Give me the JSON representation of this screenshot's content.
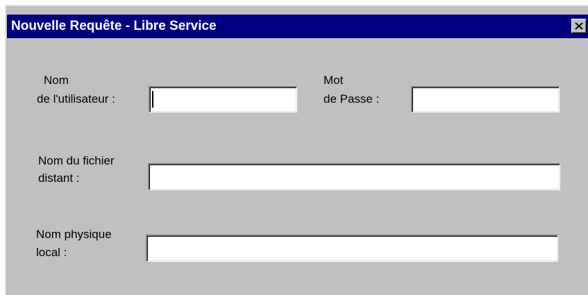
{
  "window": {
    "title": "Nouvelle Requête - Libre Service",
    "close_icon": "close-icon"
  },
  "form": {
    "username": {
      "label_line1": "Nom",
      "label_line2": "de l'utilisateur :",
      "value": ""
    },
    "password": {
      "label_line1": "Mot",
      "label_line2": "de Passe :",
      "value": ""
    },
    "remote_file": {
      "label_line1": "Nom du fichier",
      "label_line2": "distant :",
      "value": ""
    },
    "local_name": {
      "label_line1": "Nom physique",
      "label_line2": "local  :",
      "value": ""
    }
  }
}
